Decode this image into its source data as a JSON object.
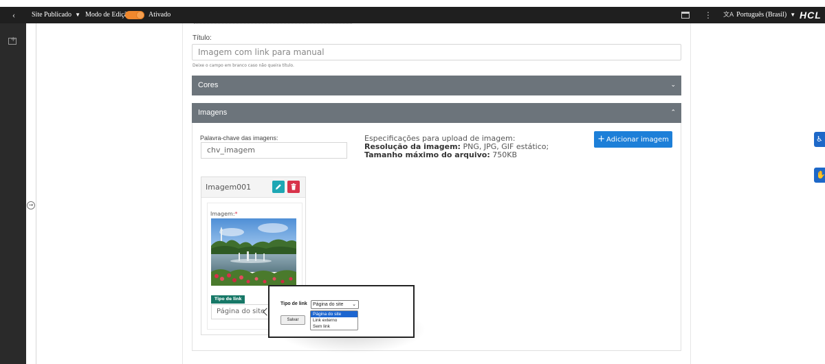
{
  "topbar": {
    "back_icon": "chevron-left-icon",
    "site_menu_label": "Site Publicado",
    "edit_mode_label": "Modo de Edição:",
    "edit_mode_state": "Ativado",
    "toggle_color": "#f0882e",
    "language_label": "Português (Brasil)",
    "brand": "HCL"
  },
  "form": {
    "title_label": "Título:",
    "title_value": "Imagem com link para manual",
    "title_hint": "Deixe o campo em branco caso não queira título."
  },
  "sections": {
    "cores_label": "Cores",
    "imagens_label": "Imagens"
  },
  "images_panel": {
    "keyword_label": "Palavra-chave das imagens:",
    "keyword_value": "chv_imagem",
    "spec_title": "Especificações para upload de imagem:",
    "resolution_label": "Resolução da imagem:",
    "resolution_value": "PNG, JPG, GIF estático;",
    "max_size_label": "Tamanho máximo do arquivo:",
    "max_size_value": "750KB",
    "add_button_label": "Adicionar imagem",
    "accent_color": "#1d7fd8"
  },
  "image_card": {
    "title": "Imagem001",
    "image_label": "Imagem:",
    "required_mark": "*",
    "link_type_badge": "Tipo de link",
    "link_type_value": "Página do site"
  },
  "popup": {
    "link_type_label": "Tipo de link",
    "selected_option": "Página do site",
    "save_label": "Salvar",
    "options": [
      "Página do site",
      "Link externo",
      "Sem link"
    ]
  }
}
